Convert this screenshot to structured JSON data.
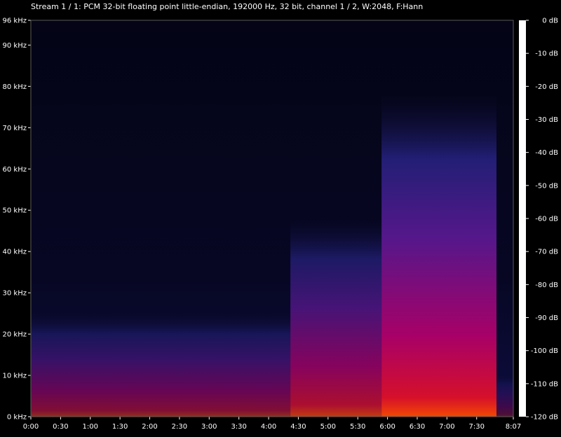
{
  "title": "Stream 1 / 1: PCM 32-bit floating point little-endian, 192000 Hz, 32 bit, channel 1 / 2, W:2048, F:Hann",
  "chart_data": {
    "type": "heatmap",
    "title": "Stream 1 / 1: PCM 32-bit floating point little-endian, 192000 Hz, 32 bit, channel 1 / 2, W:2048, F:Hann",
    "x_unit": "time",
    "x_range_seconds": [
      0,
      487
    ],
    "x_ticks": [
      "0:00",
      "0:30",
      "1:00",
      "1:30",
      "2:00",
      "2:30",
      "3:00",
      "3:30",
      "4:00",
      "4:30",
      "5:00",
      "5:30",
      "6:00",
      "6:30",
      "7:00",
      "7:30",
      "8:07"
    ],
    "y_unit": "kHz",
    "y_range": [
      0,
      96
    ],
    "y_ticks": [
      "0 kHz",
      "10 kHz",
      "20 kHz",
      "30 kHz",
      "40 kHz",
      "50 kHz",
      "60 kHz",
      "70 kHz",
      "80 kHz",
      "90 kHz",
      "96 kHz"
    ],
    "colorbar_unit": "dB",
    "colorbar_range": [
      -120,
      0
    ],
    "colorbar_ticks": [
      "0 dB",
      "-10 dB",
      "-20 dB",
      "-30 dB",
      "-40 dB",
      "-50 dB",
      "-60 dB",
      "-70 dB",
      "-80 dB",
      "-90 dB",
      "-100 dB",
      "-110 dB",
      "-120 dB"
    ],
    "colormap": [
      "#ffffff",
      "#fff6a0",
      "#ffd200",
      "#ff8a00",
      "#ff3a00",
      "#e0003a",
      "#b00070",
      "#7a1090",
      "#4a1a8a",
      "#241860",
      "#0a0a2a",
      "#000000"
    ],
    "segments": [
      {
        "start_s": 0,
        "end_s": 262,
        "max_khz": 25,
        "level": 0.55
      },
      {
        "start_s": 262,
        "end_s": 354,
        "max_khz": 48,
        "level": 0.75
      },
      {
        "start_s": 354,
        "end_s": 470,
        "max_khz": 78,
        "level": 0.95
      },
      {
        "start_s": 470,
        "end_s": 487,
        "max_khz": 10,
        "level": 0.3
      }
    ]
  }
}
